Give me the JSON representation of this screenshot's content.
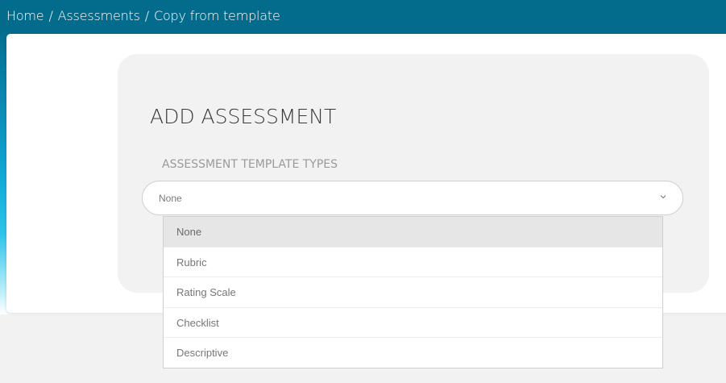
{
  "breadcrumb": {
    "home": "Home",
    "separator": "/",
    "assessments": "Assessments",
    "current": "Copy from template"
  },
  "form": {
    "title": "ADD ASSESSMENT",
    "template_types_label": "ASSESSMENT TEMPLATE TYPES",
    "selected_value": "None",
    "options": [
      "None",
      "Rubric",
      "Rating Scale",
      "Checklist",
      "Descriptive"
    ]
  },
  "colors": {
    "header": "#036b8c",
    "panel": "#f2f2f2",
    "selected_option": "#e6e6e6"
  },
  "icons": {
    "select_indicator": "chevron-down-icon"
  }
}
